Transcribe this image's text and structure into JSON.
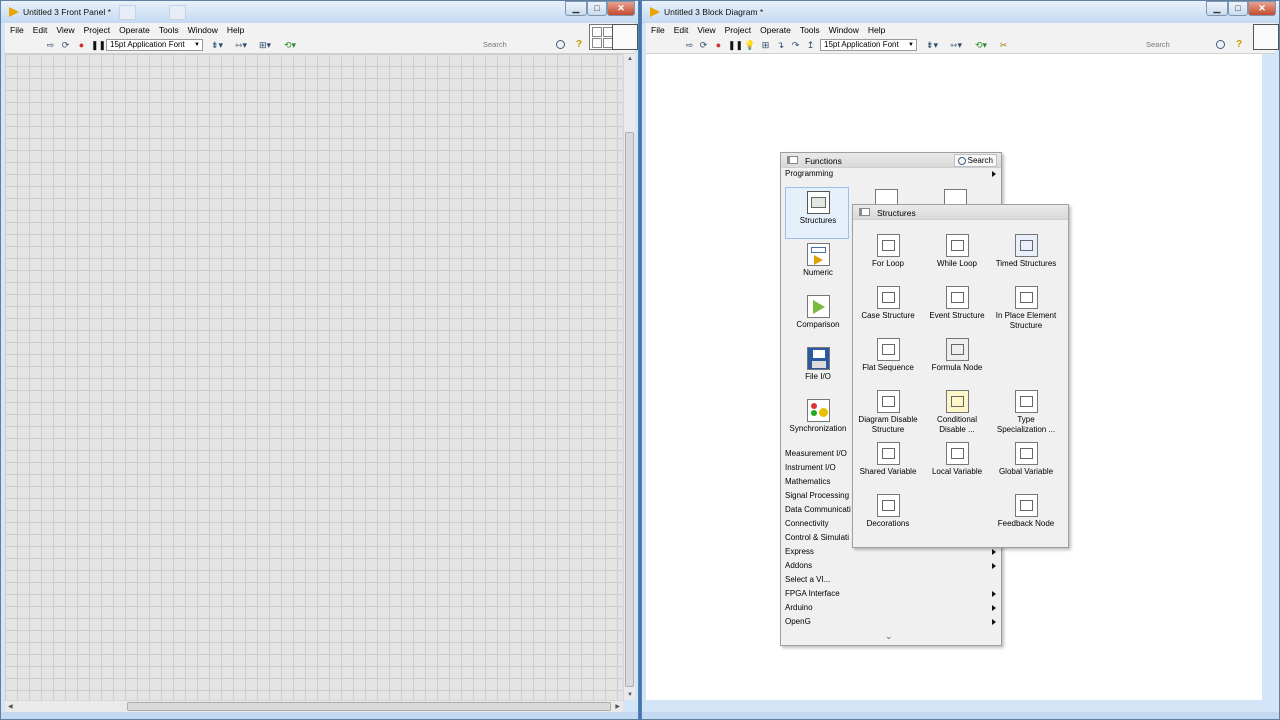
{
  "front_panel": {
    "title": "Untitled 3 Front Panel *",
    "menu": [
      "File",
      "Edit",
      "View",
      "Project",
      "Operate",
      "Tools",
      "Window",
      "Help"
    ],
    "font_select": "15pt Application Font",
    "search_placeholder": "Search",
    "help_label": "?"
  },
  "block_diagram": {
    "title": "Untitled 3 Block Diagram *",
    "menu": [
      "File",
      "Edit",
      "View",
      "Project",
      "Operate",
      "Tools",
      "Window",
      "Help"
    ],
    "font_select": "15pt Application Font",
    "search_placeholder": "Search",
    "help_label": "?"
  },
  "window_buttons": {
    "minimize": "▁",
    "maximize": "□",
    "close": "✕"
  },
  "functions_palette": {
    "title": "Functions",
    "search_label": "Search",
    "category": "Programming",
    "icon_categories": [
      "Structures",
      "Numeric",
      "Comparison",
      "File I/O",
      "Synchronization"
    ],
    "list_categories": [
      {
        "label": "Measurement I/O",
        "arrow": false
      },
      {
        "label": "Instrument I/O",
        "arrow": false
      },
      {
        "label": "Mathematics",
        "arrow": false
      },
      {
        "label": "Signal Processing",
        "arrow": false
      },
      {
        "label": "Data Communicati",
        "arrow": false
      },
      {
        "label": "Connectivity",
        "arrow": false
      },
      {
        "label": "Control & Simulati",
        "arrow": false
      },
      {
        "label": "Express",
        "arrow": true
      },
      {
        "label": "Addons",
        "arrow": true
      },
      {
        "label": "Select a VI...",
        "arrow": false
      },
      {
        "label": "FPGA Interface",
        "arrow": true
      },
      {
        "label": "Arduino",
        "arrow": true
      },
      {
        "label": "OpenG",
        "arrow": true
      }
    ],
    "more_label": "⌄"
  },
  "structures_palette": {
    "title": "Structures",
    "items": [
      {
        "label": "For Loop",
        "icon": "for-loop-icon"
      },
      {
        "label": "While Loop",
        "icon": "while-loop-icon"
      },
      {
        "label": "Timed Structures",
        "icon": "timed-structures-icon"
      },
      {
        "label": "Case Structure",
        "icon": "case-structure-icon"
      },
      {
        "label": "Event Structure",
        "icon": "event-structure-icon"
      },
      {
        "label": "In Place Element Structure",
        "icon": "in-place-element-icon"
      },
      {
        "label": "Flat Sequence",
        "icon": "flat-sequence-icon"
      },
      {
        "label": "Formula Node",
        "icon": "formula-node-icon"
      },
      {
        "label": "",
        "icon": ""
      },
      {
        "label": "Diagram Disable Structure",
        "icon": "diagram-disable-icon"
      },
      {
        "label": "Conditional Disable ...",
        "icon": "conditional-disable-icon"
      },
      {
        "label": "Type Specialization ...",
        "icon": "type-specialization-icon"
      },
      {
        "label": "Shared Variable",
        "icon": "shared-variable-icon"
      },
      {
        "label": "Local Variable",
        "icon": "local-variable-icon"
      },
      {
        "label": "Global Variable",
        "icon": "global-variable-icon"
      },
      {
        "label": "Decorations",
        "icon": "decorations-icon"
      },
      {
        "label": "",
        "icon": ""
      },
      {
        "label": "Feedback Node",
        "icon": "feedback-node-icon"
      }
    ]
  }
}
